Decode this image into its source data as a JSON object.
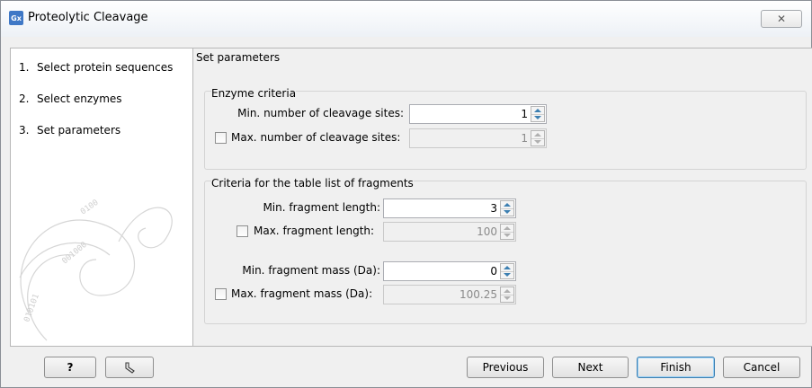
{
  "window": {
    "app_icon": "Gx",
    "title": "Proteolytic Cleavage",
    "close_icon": "close-icon",
    "close_glyph": "✕"
  },
  "steps": [
    {
      "num": "1.",
      "label": "Select protein sequences"
    },
    {
      "num": "2.",
      "label": "Select enzymes"
    },
    {
      "num": "3.",
      "label": "Set parameters"
    }
  ],
  "content": {
    "heading": "Set parameters",
    "enzyme_group": {
      "title": "Enzyme criteria",
      "min_sites": {
        "label": "Min. number of cleavage sites:",
        "value": "1"
      },
      "max_sites": {
        "label": "Max. number of cleavage sites:",
        "value": "1",
        "checked": false
      }
    },
    "fragment_group": {
      "title": "Criteria for the table list of fragments",
      "min_length": {
        "label": "Min. fragment length:",
        "value": "3"
      },
      "max_length": {
        "label": "Max. fragment length:",
        "value": "100",
        "checked": false
      },
      "min_mass": {
        "label": "Min. fragment mass (Da):",
        "value": "0"
      },
      "max_mass": {
        "label": "Max. fragment mass (Da):",
        "value": "100.25",
        "checked": false
      }
    }
  },
  "footer": {
    "help_label": "?",
    "reset_icon": "reset-icon",
    "previous_label": "Previous",
    "next_label": "Next",
    "finish_label": "Finish",
    "cancel_label": "Cancel"
  },
  "colors": {
    "accent": "#3c7fb1",
    "app_icon_bg": "#3f78c6"
  }
}
